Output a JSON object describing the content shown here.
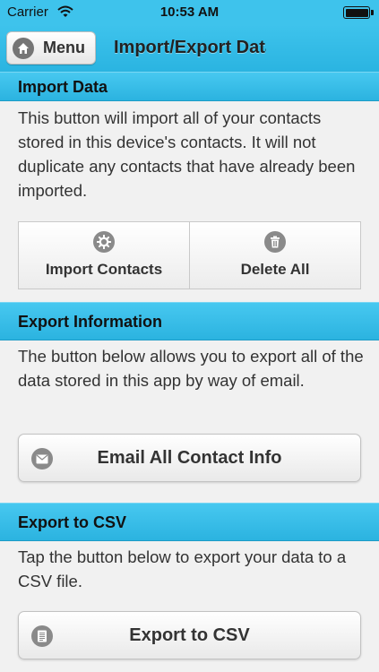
{
  "status_bar": {
    "carrier": "Carrier",
    "time": "10:53 AM"
  },
  "nav_bar": {
    "menu_label": "Menu",
    "title": "Import/Export Data"
  },
  "sections": {
    "import": {
      "header": "Import Data",
      "description": "This button will import all of your contacts stored in this device's contacts. It will not duplicate any contacts that have already been imported.",
      "buttons": [
        {
          "label": "Import Contacts",
          "icon": "gear-icon"
        },
        {
          "label": "Delete All",
          "icon": "trash-icon"
        }
      ]
    },
    "export_info": {
      "header": "Export Information",
      "description": "The button below allows you to export all of the data stored in this app by way of email.",
      "button": {
        "label": "Email All Contact Info",
        "icon": "mail-icon"
      }
    },
    "export_csv": {
      "header": "Export to CSV",
      "description": "Tap the button below to export your data to a CSV file.",
      "button": {
        "label": "Export to CSV",
        "icon": "document-icon"
      }
    }
  },
  "colors": {
    "accent": "#3ec3ec",
    "background": "#f1f1f1",
    "icon_gray": "#8a8a8a"
  }
}
